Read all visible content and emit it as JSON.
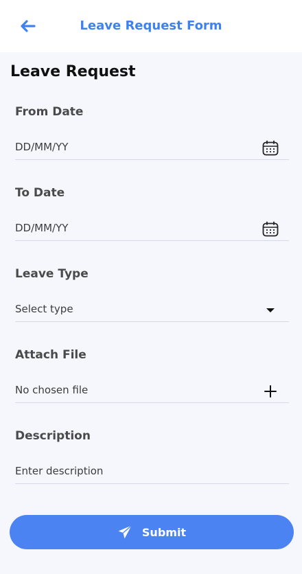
{
  "header": {
    "title": "Leave Request Form",
    "back_icon": "arrow-left-icon",
    "accent_color": "#3f82ef"
  },
  "page": {
    "title": "Leave Request"
  },
  "form": {
    "from_date": {
      "label": "From Date",
      "placeholder": "DD/MM/YY",
      "icon": "calendar-icon"
    },
    "to_date": {
      "label": "To Date",
      "placeholder": "DD/MM/YY",
      "icon": "calendar-icon"
    },
    "leave_type": {
      "label": "Leave Type",
      "placeholder": "Select type",
      "icon": "caret-down-icon"
    },
    "attach_file": {
      "label": "Attach File",
      "value": "No chosen file",
      "icon": "plus-icon"
    },
    "description": {
      "label": "Description",
      "placeholder": "Enter description"
    }
  },
  "submit": {
    "label": "Submit",
    "icon": "send-icon",
    "color": "#4b84f2"
  }
}
